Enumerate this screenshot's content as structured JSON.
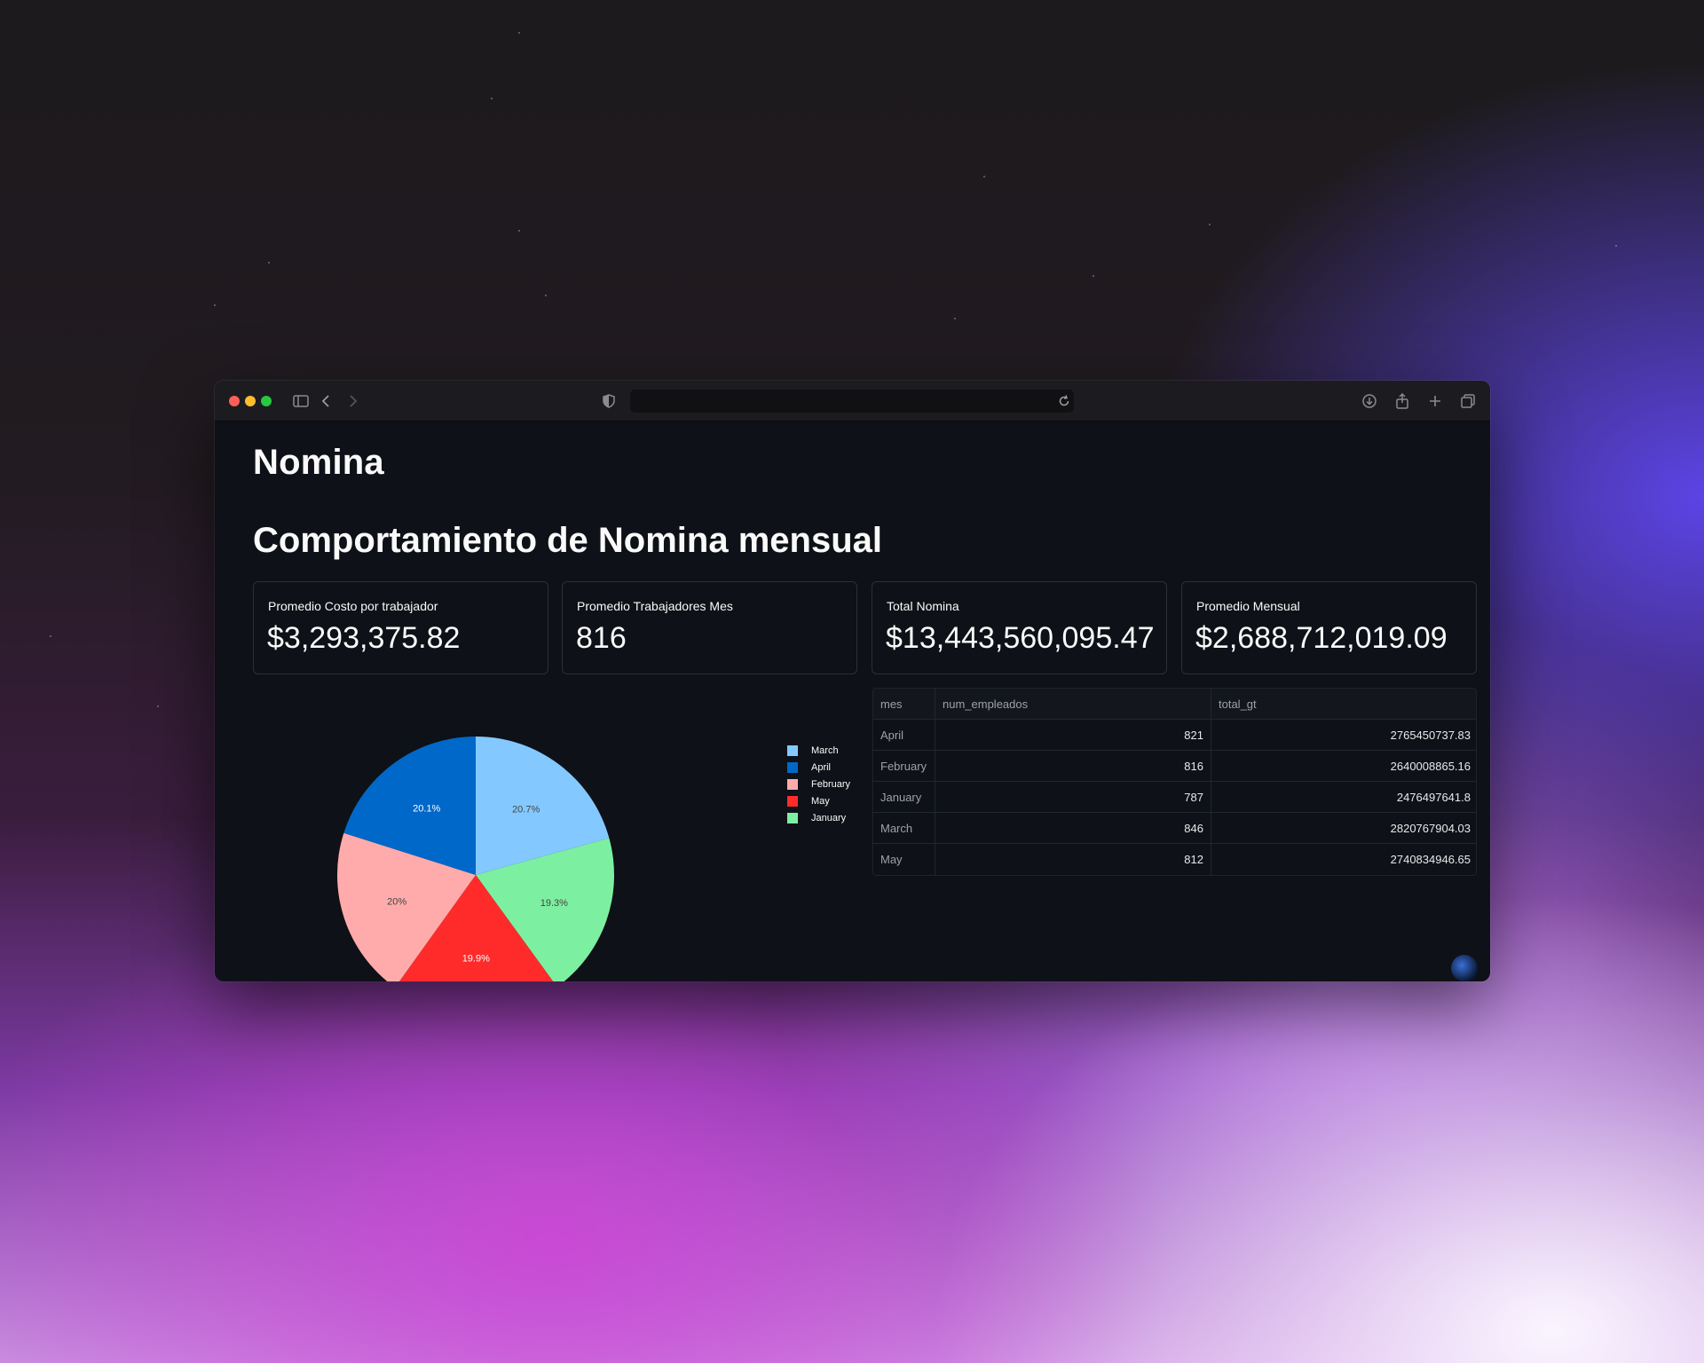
{
  "page": {
    "title": "Nomina",
    "subtitle": "Comportamiento de Nomina mensual"
  },
  "metrics": [
    {
      "label": "Promedio Costo por trabajador",
      "value": "$3,293,375.82"
    },
    {
      "label": "Promedio Trabajadores Mes",
      "value": "816"
    },
    {
      "label": "Total Nomina",
      "value": "$13,443,560,095.47"
    },
    {
      "label": "Promedio Mensual",
      "value": "$2,688,712,019.09"
    }
  ],
  "chart_data": {
    "type": "pie",
    "categories": [
      "March",
      "April",
      "February",
      "May",
      "January"
    ],
    "values": [
      20.7,
      20.1,
      20.0,
      19.9,
      19.3
    ],
    "slices": [
      {
        "label": "March",
        "value": 20.7,
        "text": "20.7%",
        "color": "#83c9ff"
      },
      {
        "label": "January",
        "value": 19.3,
        "text": "19.3%",
        "color": "#7defa1"
      },
      {
        "label": "May",
        "value": 19.9,
        "text": "19.9%",
        "color": "#ff2b2b"
      },
      {
        "label": "February",
        "value": 20.0,
        "text": "20%",
        "color": "#ffabab"
      },
      {
        "label": "April",
        "value": 20.1,
        "text": "20.1%",
        "color": "#0068c9"
      }
    ],
    "legend": [
      {
        "label": "March",
        "color": "#83c9ff"
      },
      {
        "label": "April",
        "color": "#0068c9"
      },
      {
        "label": "February",
        "color": "#ffabab"
      },
      {
        "label": "May",
        "color": "#ff2b2b"
      },
      {
        "label": "January",
        "color": "#7defa1"
      }
    ],
    "legend_position": "right"
  },
  "table": {
    "columns": [
      "mes",
      "num_empleados",
      "total_gt"
    ],
    "rows": [
      [
        "April",
        "821",
        "2765450737.83"
      ],
      [
        "February",
        "816",
        "2640008865.16"
      ],
      [
        "January",
        "787",
        "2476497641.8"
      ],
      [
        "March",
        "846",
        "2820767904.03"
      ],
      [
        "May",
        "812",
        "2740834946.65"
      ]
    ]
  },
  "icons": {
    "sidebar": "sidebar-toggle-icon",
    "back": "chevron-left-icon",
    "forward": "chevron-right-icon",
    "privacy": "shield-icon",
    "reload": "reload-icon",
    "download": "download-icon",
    "share": "share-icon",
    "new_tab": "plus-icon",
    "tabs": "tabs-overview-icon"
  }
}
